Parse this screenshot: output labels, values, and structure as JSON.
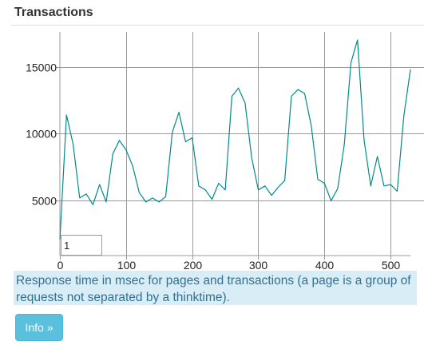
{
  "panel": {
    "title": "Transactions"
  },
  "chart_input": {
    "value": "1"
  },
  "description": {
    "text": "Response time in msec for pages and transactions (a page is a group of requests not separated by a thinktime)."
  },
  "info_button": {
    "label": "Info »"
  },
  "colors": {
    "series_line": "#008b8b",
    "grid": "#9a9a9a",
    "description_bg": "#d9edf7",
    "description_text": "#31708f",
    "button_bg": "#5bc0de"
  },
  "chart_data": {
    "type": "line",
    "title": "",
    "xlabel": "",
    "ylabel": "",
    "xlim": [
      0,
      530
    ],
    "ylim": [
      900,
      17600
    ],
    "grid": true,
    "x_ticks": [
      0,
      100,
      200,
      300,
      400,
      500
    ],
    "y_ticks": [
      5000,
      10000,
      15000
    ],
    "x_tick_labels": [
      "0",
      "100",
      "200",
      "300",
      "400",
      "500"
    ],
    "y_tick_labels": [
      "5000",
      "10000",
      "15000"
    ],
    "series": [
      {
        "x": [
          0,
          10,
          20,
          30,
          40,
          50,
          60,
          70,
          80,
          90,
          100,
          110,
          120,
          130,
          140,
          150,
          160,
          170,
          180,
          190,
          200,
          210,
          220,
          230,
          240,
          250,
          260,
          270,
          280,
          290,
          300,
          310,
          320,
          330,
          340,
          350,
          360,
          370,
          380,
          390,
          400,
          410,
          420,
          430,
          440,
          450,
          460,
          470,
          480,
          490,
          500,
          510,
          520,
          530
        ],
        "values": [
          2100,
          11400,
          9200,
          5200,
          5500,
          4700,
          6200,
          4900,
          8500,
          9500,
          8800,
          7600,
          5600,
          4900,
          5200,
          4900,
          5300,
          10100,
          11600,
          9400,
          9700,
          6100,
          5800,
          5100,
          6300,
          5800,
          12800,
          13400,
          12300,
          8200,
          5800,
          6100,
          5400,
          6000,
          6500,
          12800,
          13300,
          13000,
          10600,
          6600,
          6300,
          5000,
          5900,
          9200,
          15300,
          17000,
          9500,
          6100,
          8300,
          6100,
          6200,
          5700,
          11300,
          14800
        ]
      }
    ]
  }
}
